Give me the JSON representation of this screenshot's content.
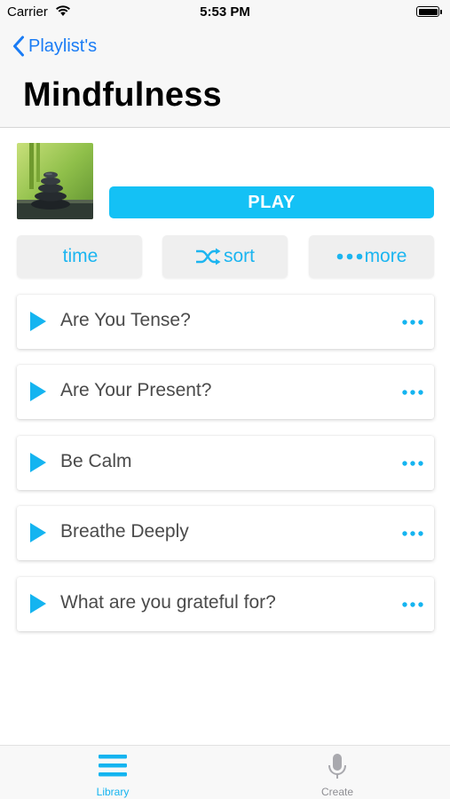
{
  "status_bar": {
    "carrier": "Carrier",
    "time": "5:53 PM",
    "wifi_icon": "wifi-icon",
    "battery_icon": "battery-icon"
  },
  "nav": {
    "back_label": "Playlist's",
    "back_icon": "chevron-left-icon",
    "title": "Mindfulness"
  },
  "playlist": {
    "thumbnail_icon": "zen-stones-image",
    "play_label": "PLAY",
    "controls": {
      "time_label": "time",
      "sort_label": "sort",
      "sort_icon": "shuffle-icon",
      "more_label": "more",
      "more_icon": "ellipsis-icon"
    }
  },
  "tracks": [
    {
      "title": "Are You Tense?"
    },
    {
      "title": "Are Your Present?"
    },
    {
      "title": "Be Calm"
    },
    {
      "title": "Breathe Deeply"
    },
    {
      "title": "What are you grateful for?"
    }
  ],
  "tab_bar": {
    "library_label": "Library",
    "library_icon": "list-icon",
    "create_label": "Create",
    "create_icon": "microphone-icon"
  },
  "colors": {
    "accent": "#14c1f5",
    "link_blue": "#1a7cf5",
    "track_text": "#4a4a4a",
    "inactive_tab": "#8e8e93"
  }
}
